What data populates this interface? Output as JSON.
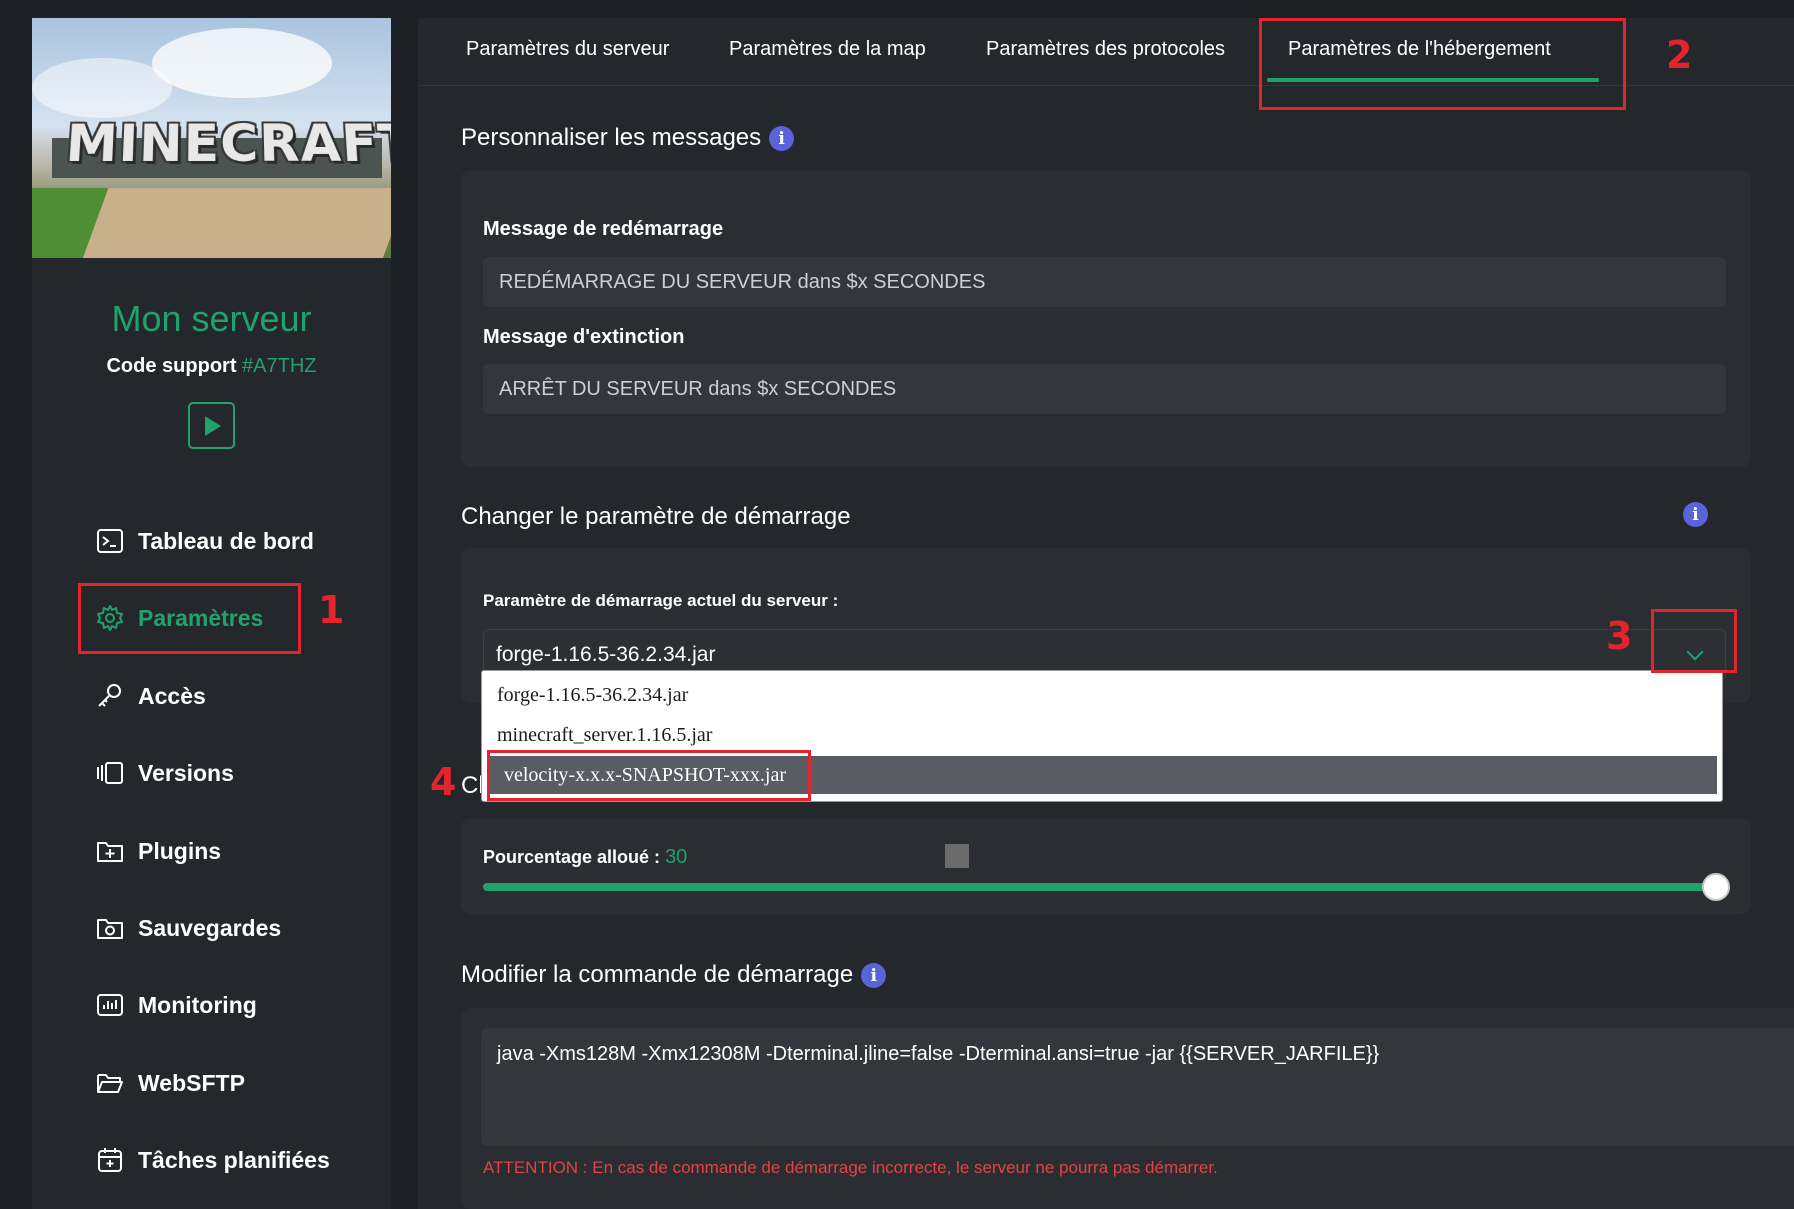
{
  "sidebar": {
    "logo_text": "MINECRAFT",
    "server_name": "Mon serveur",
    "support_label": "Code support",
    "support_code": "#A7THZ",
    "items": [
      {
        "label": "Tableau de bord",
        "icon": "terminal-icon"
      },
      {
        "label": "Paramètres",
        "icon": "gear-icon",
        "active": true
      },
      {
        "label": "Accès",
        "icon": "key-icon"
      },
      {
        "label": "Versions",
        "icon": "versions-icon"
      },
      {
        "label": "Plugins",
        "icon": "plugin-icon"
      },
      {
        "label": "Sauvegardes",
        "icon": "backup-icon"
      },
      {
        "label": "Monitoring",
        "icon": "monitoring-icon"
      },
      {
        "label": "WebSFTP",
        "icon": "folder-icon"
      },
      {
        "label": "Tâches planifiées",
        "icon": "calendar-icon"
      }
    ]
  },
  "annotations": {
    "n1": "1",
    "n2": "2",
    "n3": "3",
    "n4": "4"
  },
  "tabs": [
    {
      "label": "Paramètres du serveur"
    },
    {
      "label": "Paramètres de la map"
    },
    {
      "label": "Paramètres des protocoles"
    },
    {
      "label": "Paramètres de l'hébergement",
      "active": true
    }
  ],
  "messages": {
    "title": "Personnaliser les messages",
    "restart_label": "Message de redémarrage",
    "restart_value": "REDÉMARRAGE DU SERVEUR dans $x SECONDES",
    "shutdown_label": "Message d'extinction",
    "shutdown_value": "ARRÊT DU SERVEUR dans $x SECONDES"
  },
  "startup": {
    "title": "Changer le paramètre de démarrage",
    "current_label": "Paramètre de démarrage actuel du serveur :",
    "selected": "forge-1.16.5-36.2.34.jar",
    "options": [
      "forge-1.16.5-36.2.34.jar",
      "minecraft_server.1.16.5.jar",
      "velocity-x.x.x-SNAPSHOT-xxx.jar"
    ],
    "hidden_title_fragment": "Cl"
  },
  "cpu": {
    "label": "Pourcentage alloué :",
    "value": "30",
    "fill_fraction": 1.0
  },
  "command": {
    "title": "Modifier la commande de démarrage",
    "value": "java -Xms128M -Xmx12308M -Dterminal.jline=false -Dterminal.ansi=true -jar {{SERVER_JARFILE}}",
    "warning": "ATTENTION : En cas de commande de démarrage incorrecte, le serveur ne pourra pas démarrer."
  },
  "colors": {
    "accent": "#21a26c",
    "annotation": "#e3242b",
    "info": "#5a63d8"
  }
}
